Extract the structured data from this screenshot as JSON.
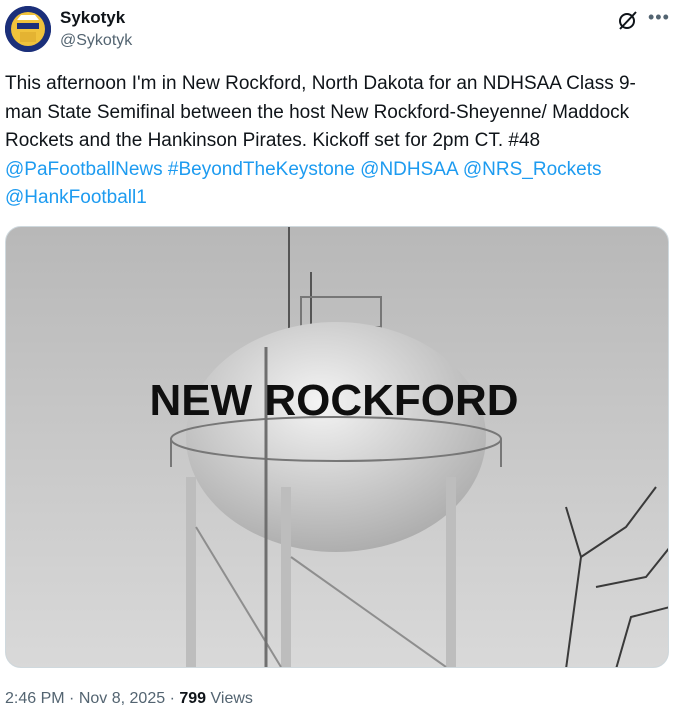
{
  "author": {
    "display_name": "Sykotyk",
    "handle": "@Sykotyk",
    "avatar_icon": "avatar-portrait"
  },
  "actions": {
    "grok_icon": "grok-slash-icon",
    "more_icon": "more-horizontal-icon"
  },
  "tweet": {
    "text_plain": "This afternoon I'm in New Rockford, North Dakota for an NDHSAA Class 9-man State Semifinal between the host New Rockford-Sheyenne/ Maddock Rockets and the Hankinson Pirates. Kickoff set for 2pm CT. #48",
    "links": [
      "@PaFootballNews",
      "#BeyondTheKeystone",
      "@NDHSAA",
      "@NRS_Rockets",
      "@HankFootball1"
    ]
  },
  "media": {
    "tower_text": "NEW ROCKFORD",
    "alt": "Water tower"
  },
  "meta": {
    "time": "2:46 PM",
    "separator": "·",
    "date": "Nov 8, 2025",
    "views_count": "799",
    "views_label": "Views"
  },
  "colors": {
    "link": "#1d9bf0",
    "secondary_text": "#536471",
    "primary_text": "#0f1419"
  }
}
